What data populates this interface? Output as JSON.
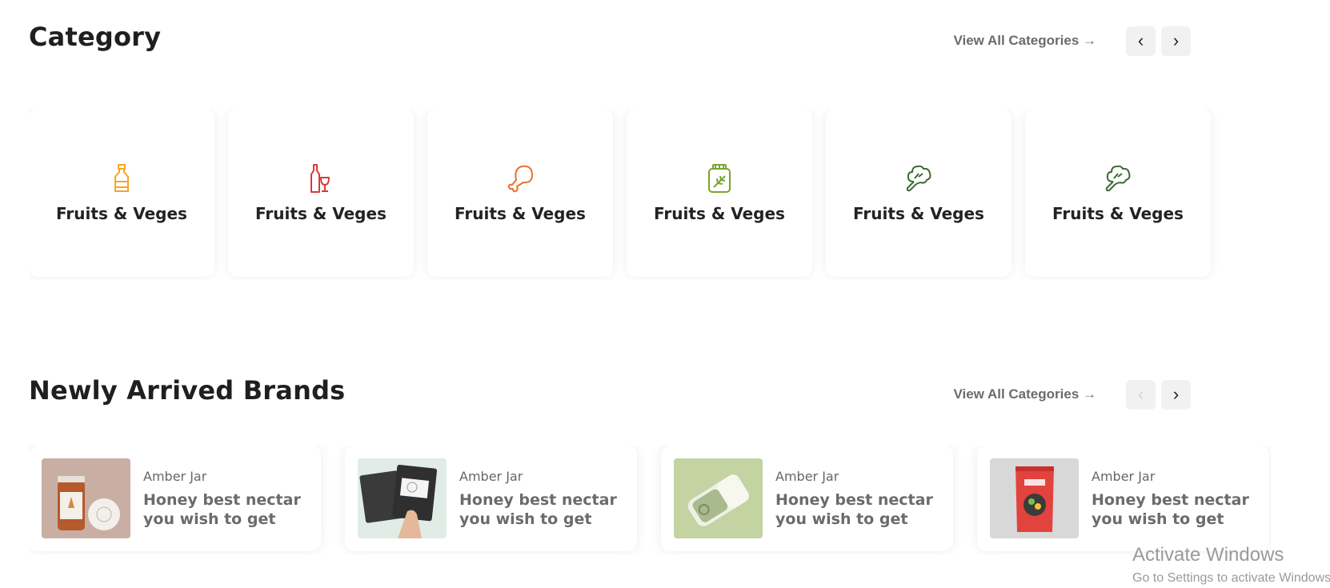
{
  "category": {
    "title": "Category",
    "view_all": "View All Categories →",
    "prev_icon": "‹",
    "next_icon": "›",
    "items": [
      {
        "label": "Fruits & Veges",
        "icon": "bottle-icon",
        "color": "#f5a623"
      },
      {
        "label": "Fruits & Veges",
        "icon": "wine-icon",
        "color": "#d63b3b"
      },
      {
        "label": "Fruits & Veges",
        "icon": "drumstick-icon",
        "color": "#e8712b"
      },
      {
        "label": "Fruits & Veges",
        "icon": "jar-herb-icon",
        "color": "#79a52f"
      },
      {
        "label": "Fruits & Veges",
        "icon": "broccoli-icon",
        "color": "#3f6b35"
      },
      {
        "label": "Fruits & Veges",
        "icon": "broccoli-icon",
        "color": "#3f6b35"
      }
    ]
  },
  "brands": {
    "title": "Newly Arrived Brands",
    "view_all": "View All Categories →",
    "prev_icon": "‹",
    "next_icon": "›",
    "items": [
      {
        "name": "Amber Jar",
        "desc_line1": "Honey best nectar",
        "desc_line2": "you wish to get",
        "image": "honey-jar-image"
      },
      {
        "name": "Amber Jar",
        "desc_line1": "Honey best nectar",
        "desc_line2": "you wish to get",
        "image": "tea-bags-image"
      },
      {
        "name": "Amber Jar",
        "desc_line1": "Honey best nectar",
        "desc_line2": "you wish to get",
        "image": "tin-can-image"
      },
      {
        "name": "Amber Jar",
        "desc_line1": "Honey best nectar",
        "desc_line2": "you wish to get",
        "image": "food-pouch-image"
      }
    ]
  },
  "watermark": {
    "line1": "Activate Windows",
    "line2": "Go to Settings to activate Windows."
  }
}
